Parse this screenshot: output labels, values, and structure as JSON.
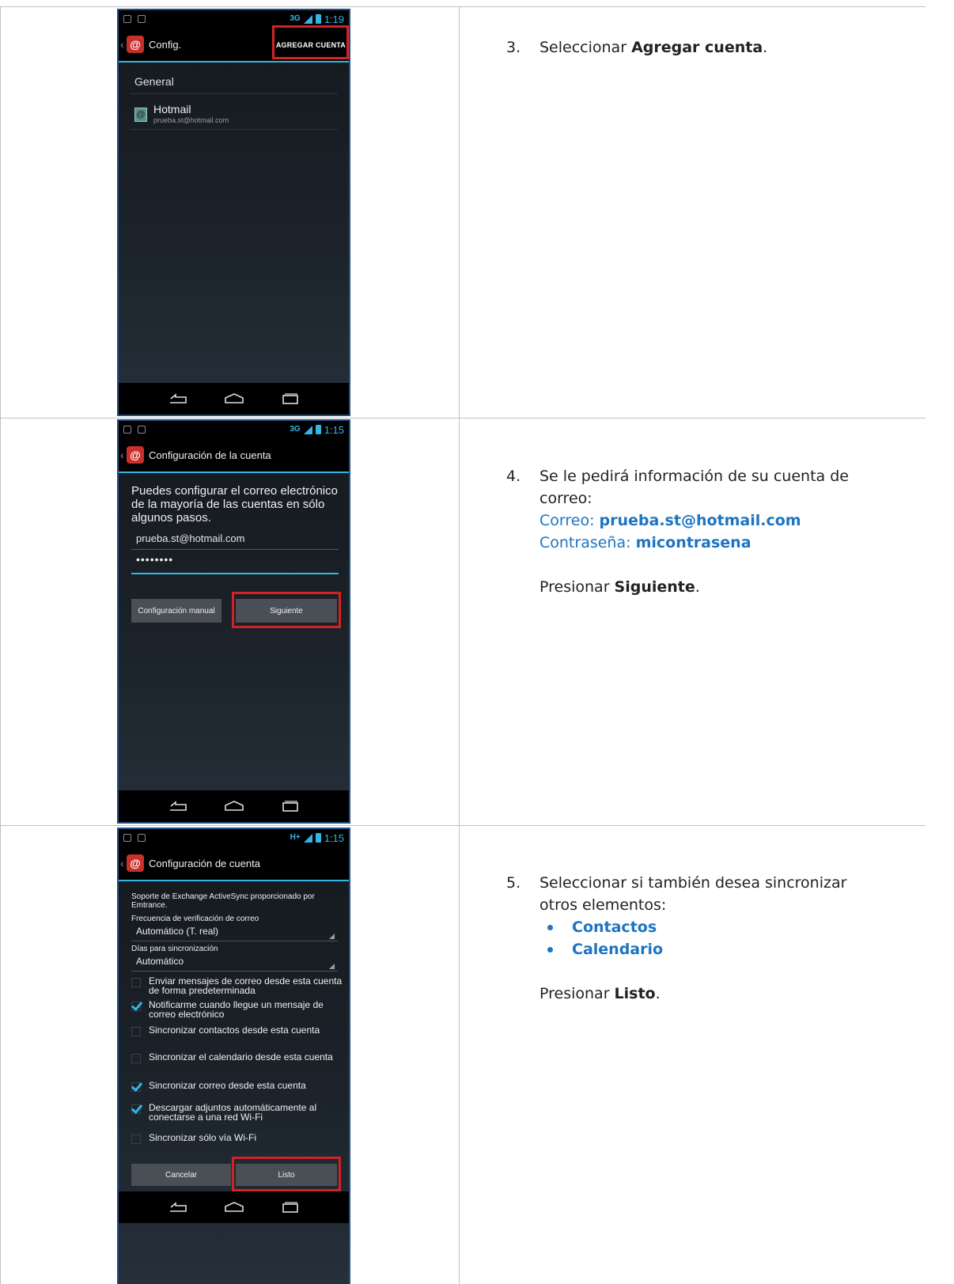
{
  "steps": [
    {
      "number": "3.",
      "text_before": "Seleccionar ",
      "text_bold": "Agregar cuenta",
      "text_after": "."
    },
    {
      "number": "4.",
      "text_line1": "Se le pedirá información de su cuenta de",
      "text_line2": "correo:",
      "email_label": "Correo: ",
      "email_value": "prueba.st@hotmail.com",
      "password_label": "Contraseña: ",
      "password_value": "micontrasena",
      "press_label": "Presionar ",
      "press_button": "Siguiente",
      "press_after": "."
    },
    {
      "number": "5.",
      "text_line1": "Seleccionar si también desea sincronizar",
      "text_line2": "otros elementos:",
      "bullets": [
        "Contactos",
        "Calendario"
      ],
      "press_label": "Presionar ",
      "press_button": "Listo",
      "press_after": "."
    }
  ],
  "screen1": {
    "time": "1:19",
    "network": "3G",
    "title": "Config.",
    "action": "AGREGAR CUENTA",
    "section": "General",
    "account_name": "Hotmail",
    "account_email": "prueba.st@hotmail.com"
  },
  "screen2": {
    "time": "1:15",
    "network": "3G",
    "title": "Configuración de la cuenta",
    "intro": "Puedes configurar el correo electrónico de la mayoría de las cuentas en sólo algunos pasos.",
    "email": "prueba.st@hotmail.com",
    "password": "••••••••",
    "manual_button": "Configuración manual",
    "next_button": "Siguiente"
  },
  "screen3": {
    "time": "1:15",
    "network": "H+",
    "title": "Configuración de cuenta",
    "support": "Soporte de Exchange ActiveSync proporcionado por Emtrance.",
    "freq_label": "Frecuencia de verificación de correo",
    "freq_value": "Automático (T. real)",
    "days_label": "Días para sincronización",
    "days_value": "Automático",
    "options": [
      {
        "label": "Enviar mensajes de correo desde esta cuenta de forma predeterminada",
        "checked": false
      },
      {
        "label": "Notificarme cuando llegue un mensaje de correo electrónico",
        "checked": true
      },
      {
        "label": "Sincronizar contactos desde esta cuenta",
        "checked": false
      },
      {
        "label": "Sincronizar el calendario desde esta cuenta",
        "checked": false
      },
      {
        "label": "Sincronizar correo desde esta cuenta",
        "checked": true
      },
      {
        "label": "Descargar adjuntos automáticamente al conectarse a una red Wi-Fi",
        "checked": true
      },
      {
        "label": "Sincronizar sólo vía Wi-Fi",
        "checked": false
      }
    ],
    "cancel_button": "Cancelar",
    "done_button": "Listo"
  },
  "colors": {
    "accent": "#33b5e5",
    "highlight": "#d42222",
    "instruction_blue": "#1e74c1"
  }
}
